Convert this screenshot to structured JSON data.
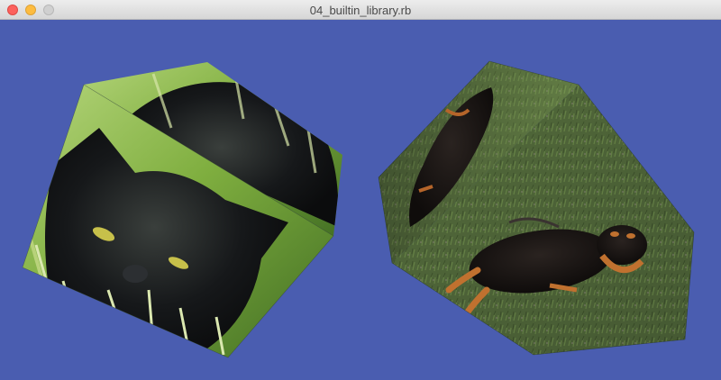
{
  "window": {
    "title": "04_builtin_library.rb",
    "buttons": [
      "close",
      "minimize",
      "zoom"
    ]
  },
  "scene": {
    "background_color": "#4a5db0",
    "objects": [
      {
        "name": "cat-cube",
        "texture": "black cat in grass"
      },
      {
        "name": "dog-cube",
        "texture": "black and tan dog lying on grass"
      }
    ]
  }
}
